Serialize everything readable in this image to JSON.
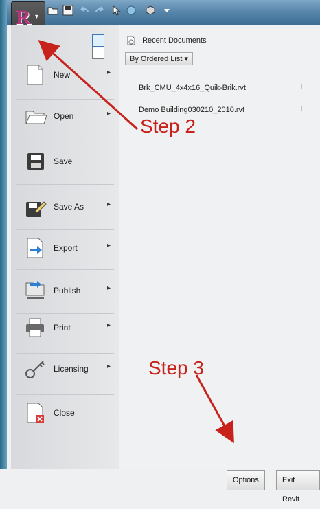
{
  "app": {
    "name": "Revit",
    "logo_letter": "R",
    "menu_key": "A"
  },
  "menu": {
    "items": [
      {
        "label": "New",
        "icon": "new-document-icon",
        "has_submenu": true
      },
      {
        "label": "Open",
        "icon": "open-folder-icon",
        "has_submenu": true
      },
      {
        "label": "Save",
        "icon": "save-icon",
        "has_submenu": false
      },
      {
        "label": "Save As",
        "icon": "save-as-icon",
        "has_submenu": true
      },
      {
        "label": "Export",
        "icon": "export-icon",
        "has_submenu": true
      },
      {
        "label": "Publish",
        "icon": "publish-icon",
        "has_submenu": true
      },
      {
        "label": "Print",
        "icon": "print-icon",
        "has_submenu": true
      },
      {
        "label": "Licensing",
        "icon": "key-icon",
        "has_submenu": true
      },
      {
        "label": "Close",
        "icon": "close-document-icon",
        "has_submenu": false
      }
    ]
  },
  "recent": {
    "title": "Recent Documents",
    "order_label": "By Ordered List",
    "docs": [
      "Brk_CMU_4x4x16_Quik-Brik.rvt",
      "Demo Building030210_2010.rvt"
    ]
  },
  "footer": {
    "options_label": "Options",
    "exit_label": "Exit Revit"
  },
  "annotations": {
    "step2": "Step 2",
    "step3": "Step 3",
    "color": "#c8221c"
  }
}
